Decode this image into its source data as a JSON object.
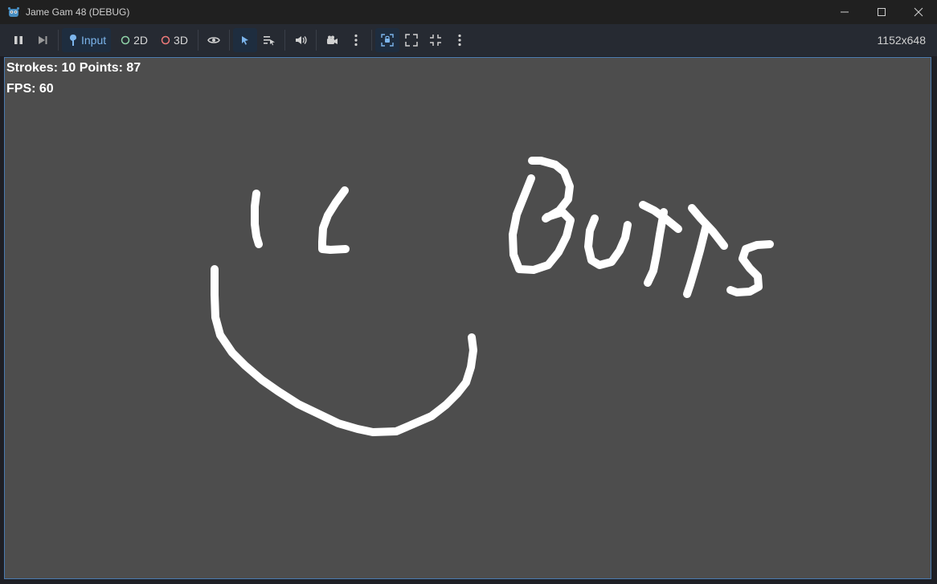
{
  "window": {
    "title": "Jame Gam 48 (DEBUG)"
  },
  "toolbar": {
    "input_label": "Input",
    "mode_2d_label": "2D",
    "mode_3d_label": "3D",
    "resolution": "1152x648"
  },
  "hud": {
    "strokes_text": "Strokes: 10 Points: 87",
    "fps_text": "FPS: 60"
  },
  "colors": {
    "accent": "#4a7bb0",
    "canvas_bg": "#4d4d4d",
    "stroke": "#ffffff",
    "mode_2d": "#8fd4a8",
    "mode_3d": "#f07a7a"
  },
  "icons": [
    "godot-logo-icon",
    "minimize-icon",
    "maximize-icon",
    "close-icon",
    "pause-icon",
    "step-icon",
    "input-icon",
    "2d-mode-icon",
    "3d-mode-icon",
    "visibility-icon",
    "select-icon",
    "list-select-icon",
    "audio-icon",
    "camera-icon",
    "more-icon",
    "embed-icon",
    "fullscreen-icon",
    "shrink-icon"
  ]
}
